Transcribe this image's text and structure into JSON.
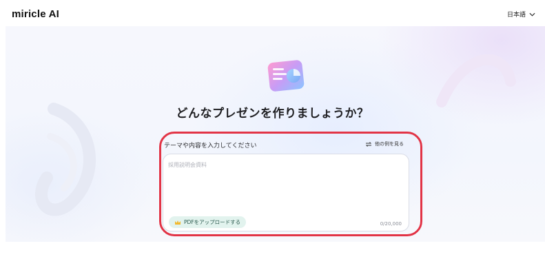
{
  "header": {
    "logo": "miricle AI",
    "language": "日本語"
  },
  "hero": {
    "headline": "どんなプレゼンを作りましょうか？"
  },
  "prompt": {
    "label": "テーマや内容を入力してください",
    "examples_link": "他の例を見る",
    "placeholder": "採用説明会資料",
    "value": "",
    "upload_button": "PDFをアップロードする",
    "char_counter": "0/20,000"
  },
  "colors": {
    "annotation": "#e23446",
    "upload_bg": "#e2f3ee",
    "crown": "#f2b82d"
  },
  "icons": {
    "language": "chevron-down-icon",
    "examples": "refresh-icon",
    "upload": "crown-icon",
    "hero": "presentation-chart-icon"
  }
}
